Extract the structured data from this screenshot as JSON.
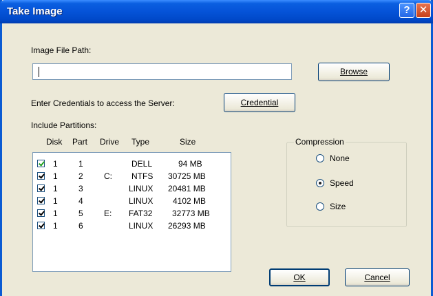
{
  "window": {
    "title": "Take Image",
    "help_glyph": "?",
    "close_glyph": "✕"
  },
  "image_path": {
    "label": "Image File Path:",
    "value": "",
    "browse_label": "Browse"
  },
  "credentials": {
    "prompt": "Enter Credentials to access the Server:",
    "button_label": "Credential"
  },
  "partitions": {
    "label": "Include Partitions:",
    "columns": [
      "Disk",
      "Part",
      "Drive",
      "Type",
      "Size"
    ],
    "rows": [
      {
        "checked": true,
        "disk": "1",
        "part": "1",
        "drive": "",
        "type": "DELL",
        "size": "94 MB"
      },
      {
        "checked": true,
        "disk": "1",
        "part": "2",
        "drive": "C:",
        "type": "NTFS",
        "size": "30725 MB"
      },
      {
        "checked": true,
        "disk": "1",
        "part": "3",
        "drive": "",
        "type": "LINUX",
        "size": "20481 MB"
      },
      {
        "checked": true,
        "disk": "1",
        "part": "4",
        "drive": "",
        "type": "LINUX",
        "size": "4102 MB"
      },
      {
        "checked": true,
        "disk": "1",
        "part": "5",
        "drive": "E:",
        "type": "FAT32",
        "size": "32773 MB"
      },
      {
        "checked": true,
        "disk": "1",
        "part": "6",
        "drive": "",
        "type": "LINUX",
        "size": "26293 MB"
      }
    ]
  },
  "compression": {
    "label": "Compression",
    "options": [
      "None",
      "Speed",
      "Size"
    ],
    "selected": "Speed"
  },
  "footer": {
    "ok_label": "OK",
    "cancel_label": "Cancel"
  },
  "colors": {
    "titlebar": "#0553d8",
    "dialog_bg": "#ece9d8",
    "check_green": "#21a121"
  }
}
